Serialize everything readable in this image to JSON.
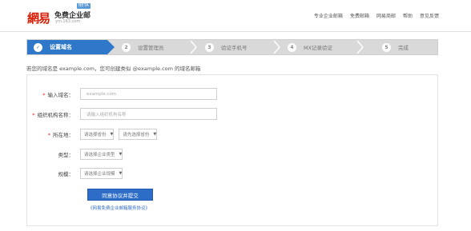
{
  "header": {
    "logo_text": "網易",
    "brand": "免费企业邮",
    "brand_url": "ym.163.com",
    "beta": "BETA",
    "nav": [
      "专业企业邮箱",
      "免费邮箱",
      "网易商邮",
      "帮助",
      "意见反馈"
    ]
  },
  "steps": [
    {
      "num": "✓",
      "label": "设置域名"
    },
    {
      "num": "2",
      "label": "设置管理员"
    },
    {
      "num": "3",
      "label": "验证手机号"
    },
    {
      "num": "4",
      "label": "MX记录验证"
    },
    {
      "num": "5",
      "label": "完成"
    }
  ],
  "hint": "若您的域名是 example.com，您可创建类似 @example.com 的域名邮箱",
  "form": {
    "domain_label": "输入域名：",
    "domain_placeholder": "example.com",
    "org_label": "组织机构名称：",
    "org_placeholder": "请输入组织机构名称",
    "location_label": "所在地：",
    "province": "请选择省份",
    "city": "请先选择省份",
    "type_label": "类型：",
    "type_value": "请选择企业类型",
    "scale_label": "规模：",
    "scale_value": "请选择企业规模",
    "submit": "同意协议并提交",
    "agreement": "《网易免费企业邮箱服务协议》"
  },
  "colors": {
    "accent": "#2e77c9",
    "required": "#e02020",
    "logo": "#d81e06"
  }
}
